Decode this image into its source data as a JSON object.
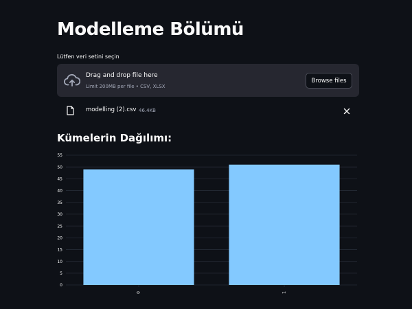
{
  "page": {
    "title": "Modelleme Bölümü"
  },
  "uploader": {
    "label": "Lütfen veri setini seçin",
    "drag_text": "Drag and drop file here",
    "limit_text": "Limit 200MB per file • CSV, XLSX",
    "browse_label": "Browse files",
    "upload_icon": "cloud-upload-icon"
  },
  "uploaded_file": {
    "name": "modelling (2).csv",
    "size": "46.4KB",
    "file_icon": "file-icon",
    "remove_icon": "close-icon"
  },
  "section": {
    "title": "Kümelerin Dağılımı:"
  },
  "colors": {
    "background": "#0e1117",
    "bar": "#83c9ff",
    "grid": "#262b36",
    "axis_text": "#fafafa"
  },
  "chart_data": {
    "type": "bar",
    "categories": [
      "0",
      "1"
    ],
    "values": [
      49,
      51
    ],
    "title": "",
    "xlabel": "",
    "ylabel": "",
    "ylim": [
      0,
      55
    ],
    "yticks": [
      0,
      5,
      10,
      15,
      20,
      25,
      30,
      35,
      40,
      45,
      50,
      55
    ],
    "grid": true
  }
}
